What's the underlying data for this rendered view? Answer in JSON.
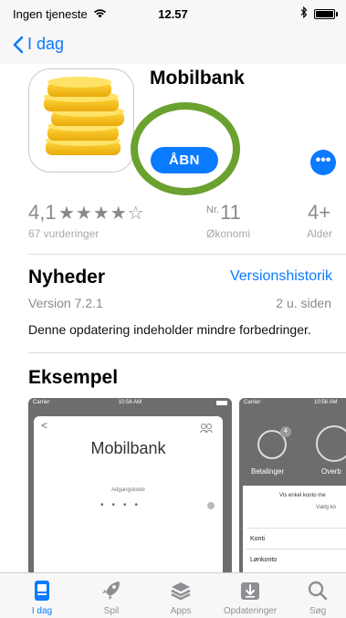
{
  "status_bar": {
    "carrier": "Ingen tjeneste",
    "time": "12.57"
  },
  "nav": {
    "back_label": "I dag"
  },
  "app": {
    "name": "Mobilbank",
    "open_label": "ÅBN",
    "more_label": "•••"
  },
  "ratings": {
    "score": "4,1",
    "stars_shown": 4,
    "stars_total": 5,
    "stars_text": "★★★★☆",
    "count_label": "67 vurderinger",
    "rank_prefix": "Nr.",
    "rank_number": "11",
    "rank_category": "Økonomi",
    "age": "4+",
    "age_label": "Alder"
  },
  "news": {
    "title": "Nyheder",
    "history_link": "Versionshistorik",
    "version": "Version 7.2.1",
    "ago": "2 u. siden",
    "description": "Denne opdatering indeholder mindre forbedringer."
  },
  "preview": {
    "title": "Eksempel",
    "shot1": {
      "carrier": "Carrier",
      "time": "10:56 AM",
      "back": "<",
      "title": "Mobilbank",
      "code_label": "Adgangskode",
      "dots": "••••"
    },
    "shot2": {
      "carrier": "Carrier",
      "time": "10:56 AM",
      "badge": "4",
      "label_left": "Betalinger",
      "label_right": "Overb",
      "line1": "Vis enkel konto me",
      "line2": "Vælg ko",
      "row1": "Konti",
      "row2": "Lønkonto"
    }
  },
  "tabs": [
    {
      "label": "I dag",
      "icon": "today-icon",
      "active": true
    },
    {
      "label": "Spil",
      "icon": "rocket-icon",
      "active": false
    },
    {
      "label": "Apps",
      "icon": "apps-stack-icon",
      "active": false
    },
    {
      "label": "Opdateringer",
      "icon": "download-icon",
      "active": false
    },
    {
      "label": "Søg",
      "icon": "search-icon",
      "active": false
    }
  ],
  "colors": {
    "accent": "#0a7aff",
    "highlight_ring": "#6aa12f",
    "coin": "#f5c518",
    "secondary_text": "#8a8a8e"
  }
}
